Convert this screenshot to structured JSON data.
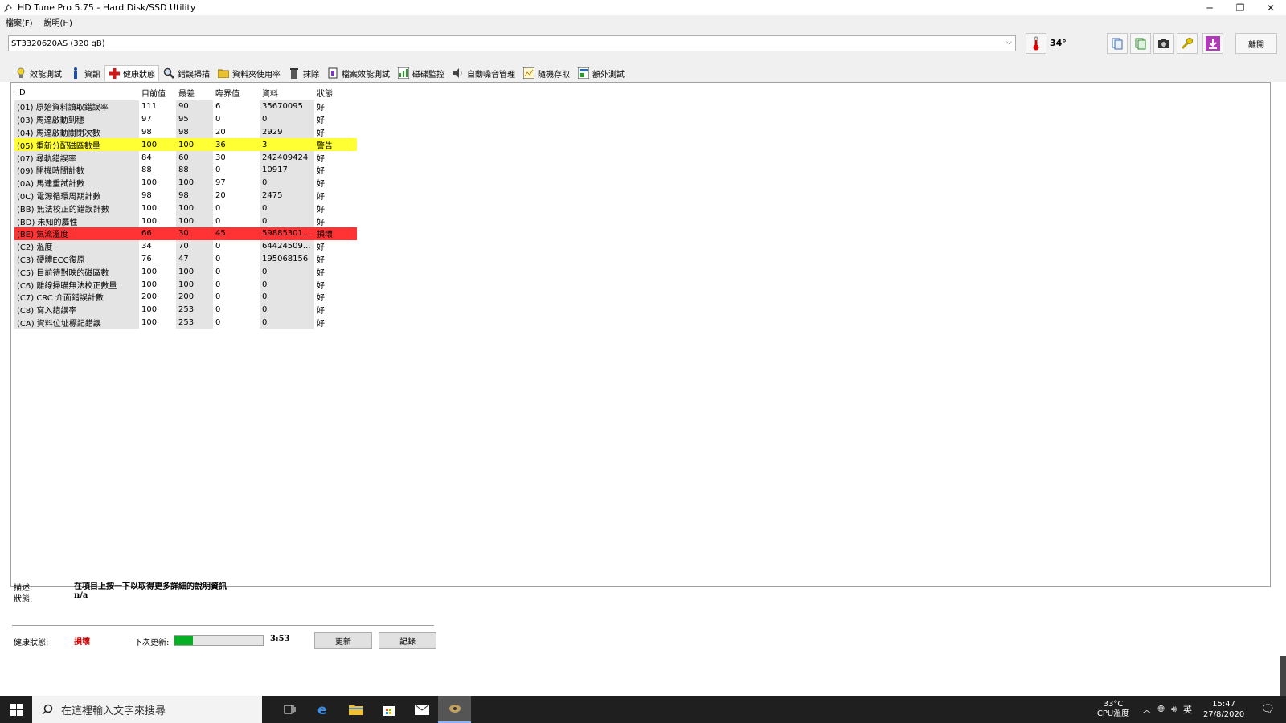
{
  "window": {
    "title": "HD Tune Pro 5.75 - Hard Disk/SSD Utility",
    "minimize": "─",
    "restore": "❐",
    "close": "✕"
  },
  "menu": [
    "檔案(F)",
    "說明(H)"
  ],
  "drive": {
    "selected": "ST3320620AS (320 gB)",
    "temperature": "34°",
    "exit_label": "離開"
  },
  "tabs": [
    {
      "label": "效能測試",
      "icon": "lightbulb-icon"
    },
    {
      "label": "資訊",
      "icon": "info-icon"
    },
    {
      "label": "健康狀態",
      "icon": "red-cross-icon"
    },
    {
      "label": "錯誤掃描",
      "icon": "magnifier-icon"
    },
    {
      "label": "資料夾使用率",
      "icon": "folder-icon"
    },
    {
      "label": "抹除",
      "icon": "trash-icon"
    },
    {
      "label": "檔案效能測試",
      "icon": "file-benchmark-icon"
    },
    {
      "label": "磁碟監控",
      "icon": "monitor-chart-icon"
    },
    {
      "label": "自動噪音管理",
      "icon": "speaker-icon"
    },
    {
      "label": "隨機存取",
      "icon": "random-access-icon"
    },
    {
      "label": "額外測試",
      "icon": "extra-tests-icon"
    }
  ],
  "active_tab": 2,
  "smart": {
    "headers": [
      "ID",
      "目前值",
      "最差",
      "臨界值",
      "資料",
      "狀態"
    ],
    "rows": [
      {
        "id": "(01) 原始資料讀取錯誤率",
        "current": "111",
        "worst": "90",
        "threshold": "6",
        "data": "35670095",
        "status": "好",
        "level": "ok"
      },
      {
        "id": "(03) 馬達啟動到穩",
        "current": "97",
        "worst": "95",
        "threshold": "0",
        "data": "0",
        "status": "好",
        "level": "ok"
      },
      {
        "id": "(04) 馬達啟動關閉次數",
        "current": "98",
        "worst": "98",
        "threshold": "20",
        "data": "2929",
        "status": "好",
        "level": "ok"
      },
      {
        "id": "(05) 重新分配磁區數量",
        "current": "100",
        "worst": "100",
        "threshold": "36",
        "data": "3",
        "status": "警告",
        "level": "warn"
      },
      {
        "id": "(07) 尋軌錯誤率",
        "current": "84",
        "worst": "60",
        "threshold": "30",
        "data": "242409424",
        "status": "好",
        "level": "ok"
      },
      {
        "id": "(09) 開機時間計數",
        "current": "88",
        "worst": "88",
        "threshold": "0",
        "data": "10917",
        "status": "好",
        "level": "ok"
      },
      {
        "id": "(0A) 馬達重試計數",
        "current": "100",
        "worst": "100",
        "threshold": "97",
        "data": "0",
        "status": "好",
        "level": "ok"
      },
      {
        "id": "(0C) 電源循環周期計數",
        "current": "98",
        "worst": "98",
        "threshold": "20",
        "data": "2475",
        "status": "好",
        "level": "ok"
      },
      {
        "id": "(BB) 無法校正的錯誤計數",
        "current": "100",
        "worst": "100",
        "threshold": "0",
        "data": "0",
        "status": "好",
        "level": "ok"
      },
      {
        "id": "(BD) 未知的屬性",
        "current": "100",
        "worst": "100",
        "threshold": "0",
        "data": "0",
        "status": "好",
        "level": "ok"
      },
      {
        "id": "(BE) 氣流溫度",
        "current": "66",
        "worst": "30",
        "threshold": "45",
        "data": "59885301...",
        "status": "損壞",
        "level": "bad"
      },
      {
        "id": "(C2) 溫度",
        "current": "34",
        "worst": "70",
        "threshold": "0",
        "data": "64424509...",
        "status": "好",
        "level": "ok"
      },
      {
        "id": "(C3) 硬體ECC復原",
        "current": "76",
        "worst": "47",
        "threshold": "0",
        "data": "195068156",
        "status": "好",
        "level": "ok"
      },
      {
        "id": "(C5) 目前待對映的磁區數",
        "current": "100",
        "worst": "100",
        "threshold": "0",
        "data": "0",
        "status": "好",
        "level": "ok"
      },
      {
        "id": "(C6) 離線掃瞄無法校正數量",
        "current": "100",
        "worst": "100",
        "threshold": "0",
        "data": "0",
        "status": "好",
        "level": "ok"
      },
      {
        "id": "(C7) CRC 介面錯誤計數",
        "current": "200",
        "worst": "200",
        "threshold": "0",
        "data": "0",
        "status": "好",
        "level": "ok"
      },
      {
        "id": "(C8) 寫入錯誤率",
        "current": "100",
        "worst": "253",
        "threshold": "0",
        "data": "0",
        "status": "好",
        "level": "ok"
      },
      {
        "id": "(CA) 資料位址標記錯誤",
        "current": "100",
        "worst": "253",
        "threshold": "0",
        "data": "0",
        "status": "好",
        "level": "ok"
      }
    ]
  },
  "details": {
    "description_label": "描述:",
    "description_value": "在項目上按一下以取得更多詳細的說明資訊",
    "status_label": "狀態:",
    "status_value": "n/a",
    "health_label": "健康狀態:",
    "health_value": "損壞",
    "next_update_label": "下次更新:",
    "progress_fraction": 0.21,
    "countdown": "3:53",
    "refresh_label": "更新",
    "log_label": "記錄"
  },
  "taskbar": {
    "search_placeholder": "在這裡輸入文字來搜尋",
    "cpu_temp": "33°C",
    "cpu_label": "CPU溫度",
    "ime": "英",
    "time": "15:47",
    "date": "27/8/2020"
  },
  "colors": {
    "warn": "#ffff33",
    "bad": "#ff3333",
    "progress": "#06b025",
    "health_bad_text": "#cc0000"
  }
}
